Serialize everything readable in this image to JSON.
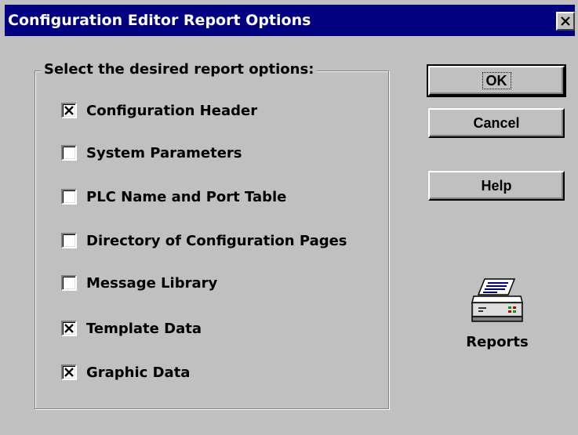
{
  "window": {
    "title": "Configuration Editor Report Options"
  },
  "group": {
    "label": "Select the desired report options:"
  },
  "options": [
    {
      "label": "Configuration Header",
      "checked": true
    },
    {
      "label": "System Parameters",
      "checked": false
    },
    {
      "label": "PLC Name and Port Table",
      "checked": false
    },
    {
      "label": "Directory of Configuration Pages",
      "checked": false
    },
    {
      "label": "Message Library",
      "checked": false
    },
    {
      "label": "Template Data",
      "checked": true
    },
    {
      "label": "Graphic Data",
      "checked": true
    }
  ],
  "buttons": {
    "ok": "OK",
    "cancel": "Cancel",
    "help": "Help"
  },
  "reports": {
    "label": "Reports",
    "icon": "printer-icon"
  },
  "colors": {
    "titlebar": "#000080",
    "face": "#c0c0c0"
  }
}
